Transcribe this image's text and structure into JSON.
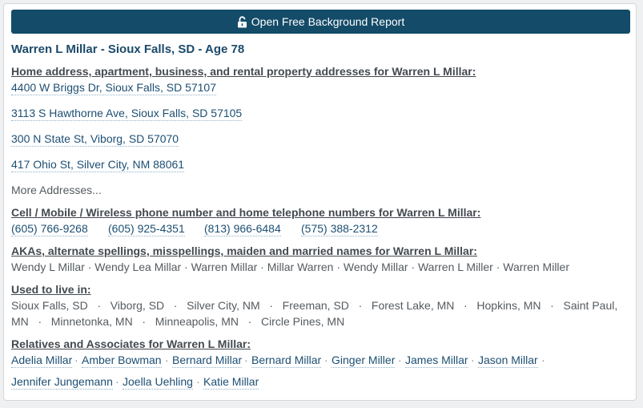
{
  "report_button": {
    "label": "Open Free Background Report",
    "icon": "unlock-icon"
  },
  "title": "Warren L Millar - Sioux Falls, SD - Age 78",
  "addresses": {
    "heading": "Home address, apartment, business, and rental property addresses for Warren L Millar:",
    "items": [
      "4400 W Briggs Dr, Sioux Falls, SD 57107",
      "3113 S Hawthorne Ave, Sioux Falls, SD 57105",
      "300 N State St, Viborg, SD 57070",
      "417 Ohio St, Silver City, NM 88061"
    ],
    "more": "More Addresses..."
  },
  "phones": {
    "heading": "Cell / Mobile / Wireless phone number and home telephone numbers for Warren L Millar:",
    "items": [
      "(605) 766-9268",
      "(605) 925-4351",
      "(813) 966-6484",
      "(575) 388-2312"
    ]
  },
  "akas": {
    "heading": "AKAs, alternate spellings, misspellings, maiden and married names for Warren L Millar:",
    "text": "Wendy L Millar · Wendy Lea Millar · Warren Millar · Millar Warren · Wendy Millar · Warren L Miller · Warren Miller"
  },
  "lived_in": {
    "heading": "Used to live in:",
    "line1": "Sioux Falls, SD   ·   Viborg, SD   ·   Silver City, NM   ·   Freeman, SD   ·   Forest Lake, MN   ·   Hopkins, MN   ·   Saint Paul,",
    "line2": "MN   ·   Minnetonka, MN   ·   Minneapolis, MN   ·   Circle Pines, MN"
  },
  "relatives": {
    "heading": "Relatives and Associates for Warren L Millar:",
    "items": [
      "Adelia Millar",
      "Amber Bowman",
      "Bernard Millar",
      "Bernard Millar",
      "Ginger Miller",
      "James Millar",
      "Jason Millar",
      "Jennifer Jungemann",
      "Joella Uehling",
      "Katie Millar"
    ],
    "separator": "·"
  }
}
